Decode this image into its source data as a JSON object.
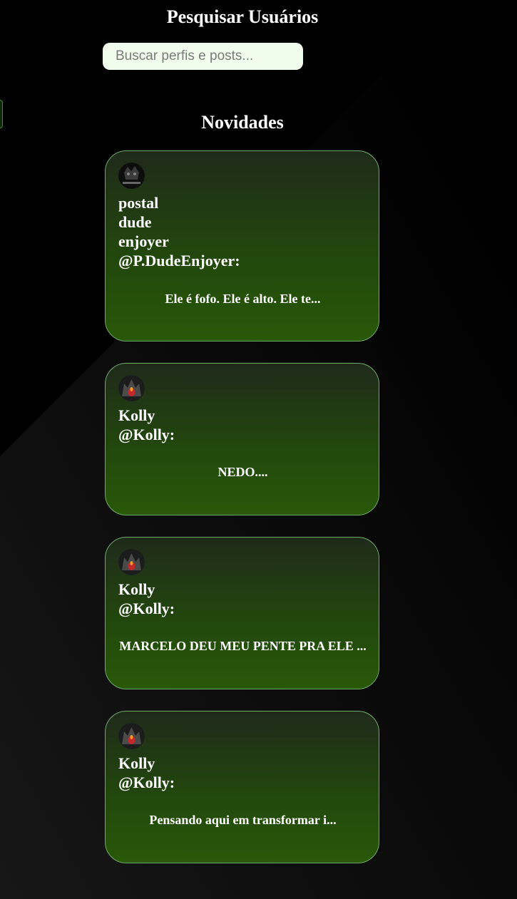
{
  "search": {
    "title": "Pesquisar Usuários",
    "placeholder": "Buscar perfis e posts...",
    "value": ""
  },
  "feed": {
    "title": "Novidades",
    "posts": [
      {
        "author": "postal dude enjoyer",
        "handle": "@P.DudeEnjoyer:",
        "text": "Ele é fofo. Ele é alto. Ele te...",
        "avatar_icon": "dark-character-avatar-icon"
      },
      {
        "author": "Kolly",
        "handle": "@Kolly:",
        "text": "NEDO....",
        "avatar_icon": "demon-avatar-icon"
      },
      {
        "author": "Kolly",
        "handle": "@Kolly:",
        "text": "MARCELO DEU MEU PENTE PRA ELE ...",
        "avatar_icon": "demon-avatar-icon"
      },
      {
        "author": "Kolly",
        "handle": "@Kolly:",
        "text": "Pensando aqui em transformar i...",
        "avatar_icon": "demon-avatar-icon"
      }
    ]
  },
  "colors": {
    "background": "#000000",
    "card_border": "#6fa86a",
    "card_gradient_top": "#1f2a1a",
    "card_gradient_bottom": "#285808",
    "input_background": "#f1fdec"
  }
}
